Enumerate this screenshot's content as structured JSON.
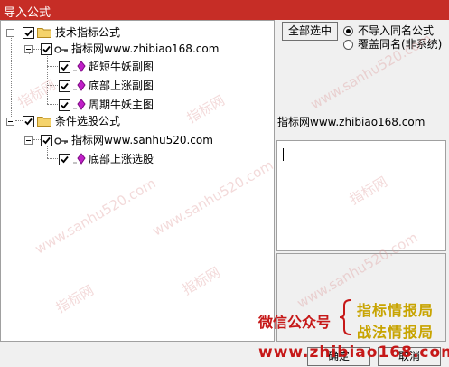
{
  "window": {
    "title": "导入公式"
  },
  "tree": {
    "groups": [
      {
        "label": "技术指标公式",
        "checked": true,
        "source": {
          "label": "指标网www.zhibiao168.com",
          "checked": true,
          "items": [
            {
              "label": "超短牛妖副图",
              "checked": true
            },
            {
              "label": "底部上涨副图",
              "checked": true
            },
            {
              "label": "周期牛妖主图",
              "checked": true
            }
          ]
        }
      },
      {
        "label": "条件选股公式",
        "checked": true,
        "source": {
          "label": "指标网www.sanhu520.com",
          "checked": true,
          "items": [
            {
              "label": "底部上涨选股",
              "checked": true
            }
          ]
        }
      }
    ]
  },
  "options": {
    "select_all_label": "全部选中",
    "radios": [
      {
        "label": "不导入同名公式",
        "selected": true
      },
      {
        "label": "覆盖同名(非系统)",
        "selected": false
      }
    ]
  },
  "detail": {
    "source_label": "指标网www.zhibiao168.com",
    "text_value": ""
  },
  "watermark": {
    "text_a": "www.sanhu520.com",
    "text_b": "指标网"
  },
  "promo": {
    "wechat_label": "微信公众号",
    "line1": "指标情报局",
    "line2": "战法情报局",
    "url": "www.zhibiao168.com",
    "color_red": "#c61818",
    "color_gold": "#c8a400"
  },
  "buttons": {
    "ok": "确定",
    "cancel": "取消"
  }
}
